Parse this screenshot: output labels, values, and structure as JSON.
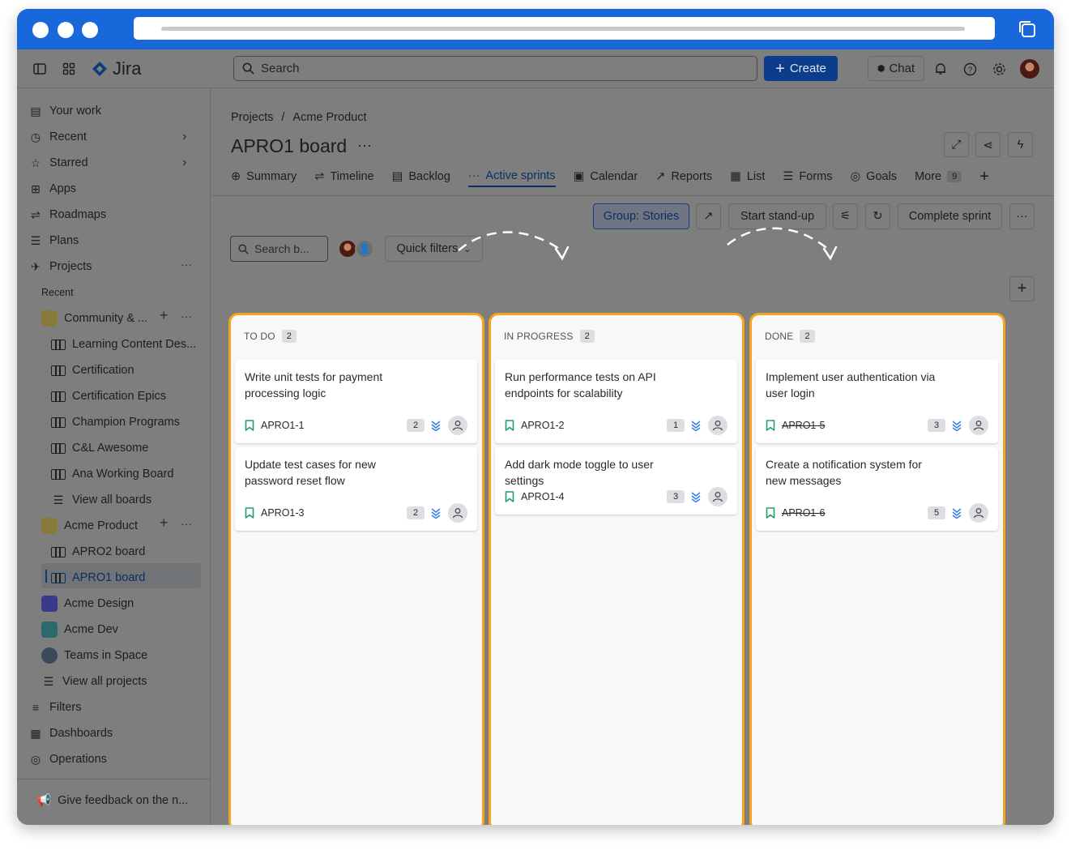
{
  "topbar": {
    "app_name": "Jira",
    "search_placeholder": "Search",
    "create_label": "Create",
    "chat_label": "Chat"
  },
  "sidebar": {
    "your_work": "Your work",
    "recent": "Recent",
    "starred": "Starred",
    "apps": "Apps",
    "roadmaps": "Roadmaps",
    "plans": "Plans",
    "projects": "Projects",
    "recent_heading": "Recent",
    "community": "Community & ...",
    "boards": [
      "Learning Content Des...",
      "Certification",
      "Certification Epics",
      "Champion Programs",
      "C&L Awesome",
      "Ana Working Board"
    ],
    "view_all_boards": "View all boards",
    "acme_product": "Acme Product",
    "apro2": "APRO2 board",
    "apro1": "APRO1 board",
    "acme_design": "Acme Design",
    "acme_dev": "Acme Dev",
    "teams_in_space": "Teams in Space",
    "view_all_projects": "View all projects",
    "filters": "Filters",
    "dashboards": "Dashboards",
    "operations": "Operations",
    "feedback": "Give feedback on the n..."
  },
  "header": {
    "breadcrumb_projects": "Projects",
    "breadcrumb_sep": "/",
    "breadcrumb_project": "Acme Product",
    "title": "APRO1 board",
    "tabs": [
      "Summary",
      "Timeline",
      "Backlog",
      "Active sprints",
      "Calendar",
      "Reports",
      "List",
      "Forms",
      "Goals"
    ],
    "more_label": "More",
    "more_count": "9"
  },
  "toolbar": {
    "group_label": "Group: Stories",
    "standup_label": "Start stand-up",
    "complete_label": "Complete sprint",
    "search_placeholder": "Search b...",
    "quick_filters": "Quick filters"
  },
  "columns": [
    {
      "name": "TO DO",
      "count": "2",
      "cards": [
        {
          "title": "Write unit tests for payment processing logic",
          "key": "APRO1-1",
          "estimate": "2",
          "done": false
        },
        {
          "title": "Update test cases for new password reset flow",
          "key": "APRO1-3",
          "estimate": "2",
          "done": false
        }
      ]
    },
    {
      "name": "IN PROGRESS",
      "count": "2",
      "cards": [
        {
          "title": "Run performance tests on API endpoints for scalability",
          "key": "APRO1-2",
          "estimate": "1",
          "done": false
        },
        {
          "title": "Add dark mode toggle to user settings",
          "key": "APRO1-4",
          "estimate": "3",
          "done": false
        }
      ]
    },
    {
      "name": "DONE",
      "count": "2",
      "cards": [
        {
          "title": "Implement user authentication via user login",
          "key": "APRO1-5",
          "estimate": "3",
          "done": true
        },
        {
          "title": "Create a notification system for new messages",
          "key": "APRO1-6",
          "estimate": "5",
          "done": true
        }
      ]
    }
  ],
  "colors": {
    "chrome": "#1868db",
    "highlight": "#f5a41d",
    "bookmark": "#22a06b",
    "priority": "#357de8"
  }
}
